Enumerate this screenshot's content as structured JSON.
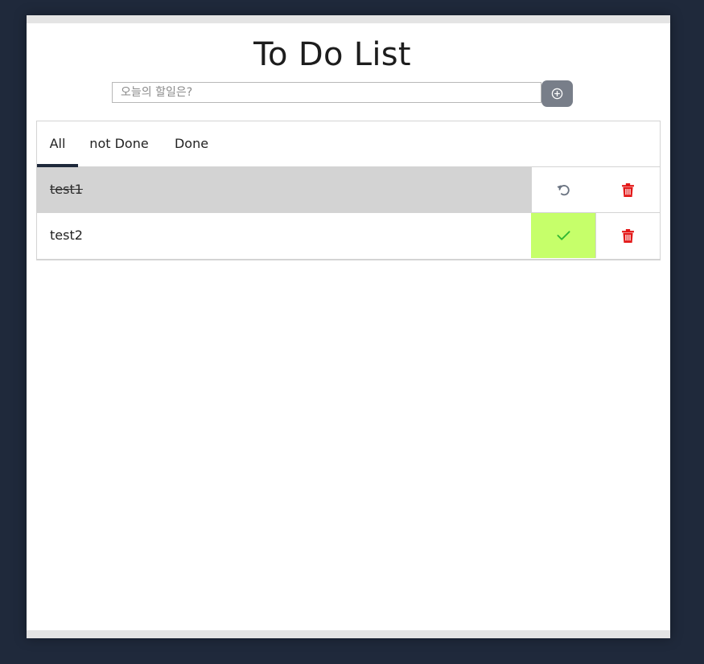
{
  "app": {
    "title": "To Do List"
  },
  "input": {
    "placeholder": "오늘의 할일은?",
    "value": ""
  },
  "add_button": {
    "icon": "plus-circle-icon"
  },
  "tabs": [
    {
      "label": "All",
      "active": true
    },
    {
      "label": "not Done",
      "active": false
    },
    {
      "label": "Done",
      "active": false
    }
  ],
  "tasks": [
    {
      "text": "test1",
      "done": true,
      "toggle_icon": "undo-icon",
      "delete_icon": "trash-icon"
    },
    {
      "text": "test2",
      "done": false,
      "toggle_icon": "check-icon",
      "delete_icon": "trash-icon"
    }
  ],
  "colors": {
    "background": "#1f293b",
    "card": "#ffffff",
    "done_row": "#d3d3d3",
    "check_cell": "#c6ff6a",
    "check_icon": "#33b833",
    "delete_icon": "#e31717",
    "undo_icon": "#6b7482",
    "add_button": "#787e89",
    "active_tab_underline": "#1f293b"
  }
}
